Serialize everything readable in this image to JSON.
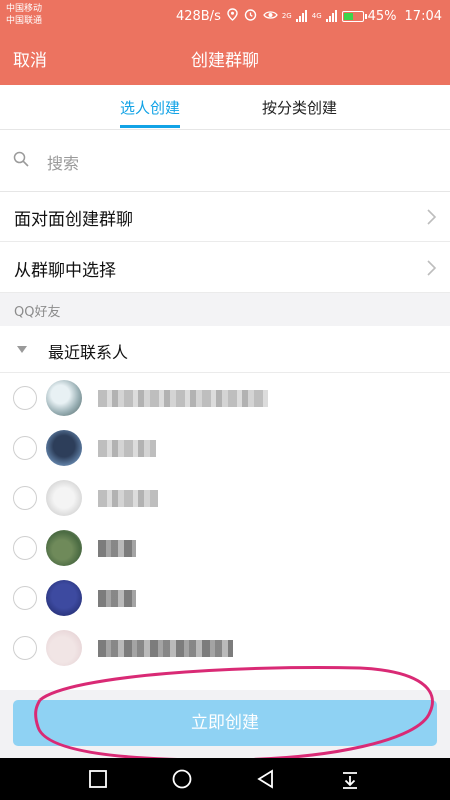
{
  "status_bar": {
    "carrier_1": "中国移动",
    "carrier_2": "中国联通",
    "speed": "428B/s",
    "battery": "45%",
    "time": "17:04",
    "net_1": "2G",
    "net_2": "4G",
    "icons": [
      "location-icon",
      "alarm-icon",
      "eye-icon",
      "signal-icon",
      "battery-icon"
    ]
  },
  "header": {
    "cancel_label": "取消",
    "title": "创建群聊",
    "background": "#ec7360"
  },
  "tabs": [
    {
      "label": "选人创建",
      "active": true
    },
    {
      "label": "按分类创建",
      "active": false
    }
  ],
  "accent_color": "#12a3e6",
  "search": {
    "placeholder": "搜索"
  },
  "options": [
    {
      "label": "面对面创建群聊"
    },
    {
      "label": "从群聊中选择"
    }
  ],
  "section_label": "QQ好友",
  "group": {
    "label": "最近联系人",
    "expanded": true
  },
  "contacts": [
    {
      "avatar": "avatar-1",
      "name_blurred": true,
      "selected": false
    },
    {
      "avatar": "avatar-2",
      "name_blurred": true,
      "selected": false
    },
    {
      "avatar": "avatar-3",
      "name_blurred": true,
      "selected": false
    },
    {
      "avatar": "avatar-4",
      "name_blurred": true,
      "selected": false
    },
    {
      "avatar": "avatar-5",
      "name_blurred": true,
      "selected": false
    },
    {
      "avatar": "avatar-6",
      "name_blurred": true,
      "selected": false
    }
  ],
  "create_button": {
    "label": "立即创建",
    "color": "#8fd2f3"
  },
  "nav_buttons": [
    "recent-apps-icon",
    "home-icon",
    "back-icon",
    "notification-pull-icon"
  ]
}
